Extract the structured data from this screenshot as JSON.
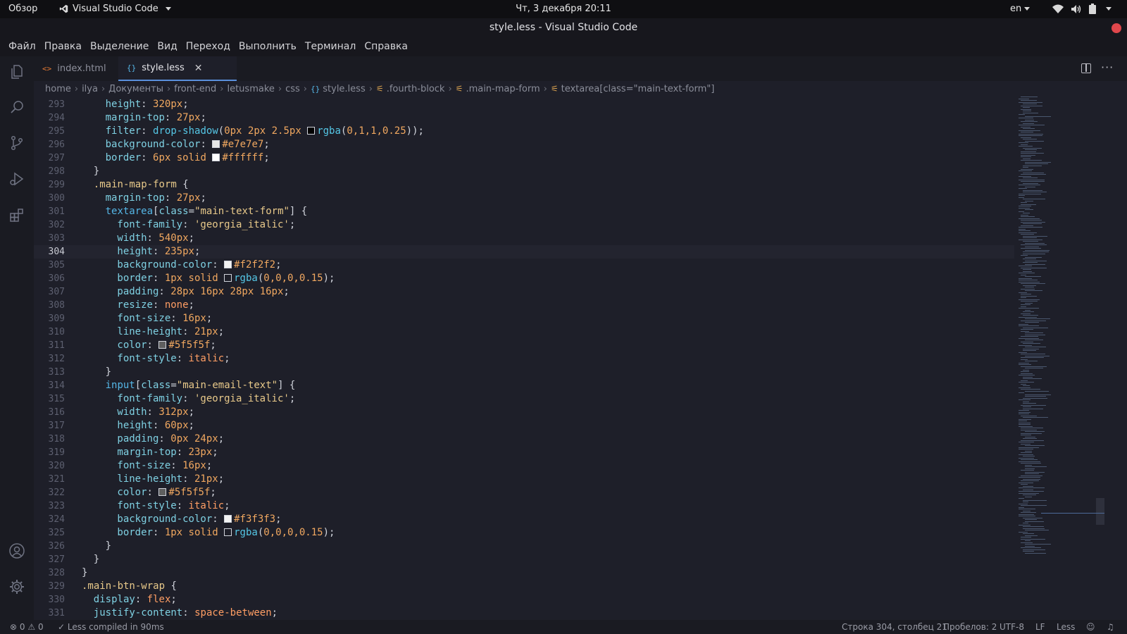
{
  "topbar": {
    "overview": "Обзор",
    "app_name": "Visual Studio Code",
    "clock": "Чт, 3 декабря  20:11",
    "language": "en"
  },
  "window": {
    "title": "style.less - Visual Studio Code"
  },
  "menu": [
    "Файл",
    "Правка",
    "Выделение",
    "Вид",
    "Переход",
    "Выполнить",
    "Терминал",
    "Справка"
  ],
  "tabs": [
    {
      "label": "index.html",
      "icon": "<>"
    },
    {
      "label": "style.less",
      "icon": "{}"
    }
  ],
  "breadcrumb": {
    "folders": [
      "home",
      "ilya",
      "Документы",
      "front-end",
      "letusmake",
      "css"
    ],
    "file": "style.less",
    "symbols": [
      ".fourth-block",
      ".main-map-form",
      "textarea[class=\"main-text-form\"]"
    ]
  },
  "editor": {
    "current_line": 304,
    "lines": [
      {
        "n": "293",
        "i": 2,
        "t": [
          [
            "p",
            "height"
          ],
          [
            "w",
            ": "
          ],
          [
            "n",
            "320px"
          ],
          [
            "w",
            ";"
          ]
        ]
      },
      {
        "n": "294",
        "i": 2,
        "t": [
          [
            "p",
            "margin-top"
          ],
          [
            "w",
            ": "
          ],
          [
            "n",
            "27px"
          ],
          [
            "w",
            ";"
          ]
        ]
      },
      {
        "n": "295",
        "i": 2,
        "t": [
          [
            "p",
            "filter"
          ],
          [
            "w",
            ": "
          ],
          [
            "f",
            "drop-shadow"
          ],
          [
            "w",
            "("
          ],
          [
            "n",
            "0px 2px 2.5px "
          ],
          [
            "sw",
            "#010101"
          ],
          [
            "f",
            "rgba"
          ],
          [
            "w",
            "("
          ],
          [
            "n",
            "0,1,1,0.25"
          ],
          [
            "w",
            "));"
          ]
        ]
      },
      {
        "n": "296",
        "i": 2,
        "t": [
          [
            "p",
            "background-color"
          ],
          [
            "w",
            ": "
          ],
          [
            "sw",
            "#e7e7e7"
          ],
          [
            "n",
            "#e7e7e7"
          ],
          [
            "w",
            ";"
          ]
        ]
      },
      {
        "n": "297",
        "i": 2,
        "t": [
          [
            "p",
            "border"
          ],
          [
            "w",
            ": "
          ],
          [
            "n",
            "6px solid "
          ],
          [
            "sw",
            "#ffffff"
          ],
          [
            "n",
            "#ffffff"
          ],
          [
            "w",
            ";"
          ]
        ]
      },
      {
        "n": "298",
        "i": 1,
        "t": [
          [
            "w",
            "}"
          ]
        ]
      },
      {
        "n": "299",
        "i": 1,
        "t": [
          [
            "sel",
            ".main-map-form"
          ],
          [
            "w",
            " {"
          ]
        ]
      },
      {
        "n": "300",
        "i": 2,
        "t": [
          [
            "p",
            "margin-top"
          ],
          [
            "w",
            ": "
          ],
          [
            "n",
            "27px"
          ],
          [
            "w",
            ";"
          ]
        ]
      },
      {
        "n": "301",
        "i": 2,
        "t": [
          [
            "k",
            "textarea"
          ],
          [
            "w",
            "["
          ],
          [
            "p",
            "class"
          ],
          [
            "w",
            "="
          ],
          [
            "s",
            "\"main-text-form\""
          ],
          [
            "w",
            "] {"
          ]
        ]
      },
      {
        "n": "302",
        "i": 3,
        "t": [
          [
            "p",
            "font-family"
          ],
          [
            "w",
            ": "
          ],
          [
            "s",
            "'georgia_italic'"
          ],
          [
            "w",
            ";"
          ]
        ]
      },
      {
        "n": "303",
        "i": 3,
        "t": [
          [
            "p",
            "width"
          ],
          [
            "w",
            ": "
          ],
          [
            "n",
            "540px"
          ],
          [
            "w",
            ";"
          ]
        ]
      },
      {
        "n": "304",
        "i": 3,
        "t": [
          [
            "p",
            "height"
          ],
          [
            "w",
            ": "
          ],
          [
            "n",
            "235px"
          ],
          [
            "w",
            ";"
          ]
        ]
      },
      {
        "n": "305",
        "i": 3,
        "t": [
          [
            "p",
            "background-color"
          ],
          [
            "w",
            ": "
          ],
          [
            "sw",
            "#f2f2f2"
          ],
          [
            "n",
            "#f2f2f2"
          ],
          [
            "w",
            ";"
          ]
        ]
      },
      {
        "n": "306",
        "i": 3,
        "t": [
          [
            "p",
            "border"
          ],
          [
            "w",
            ": "
          ],
          [
            "n",
            "1px solid "
          ],
          [
            "sw",
            "#1e1f29"
          ],
          [
            "f",
            "rgba"
          ],
          [
            "w",
            "("
          ],
          [
            "n",
            "0,0,0,0.15"
          ],
          [
            "w",
            ");"
          ]
        ]
      },
      {
        "n": "307",
        "i": 3,
        "t": [
          [
            "p",
            "padding"
          ],
          [
            "w",
            ": "
          ],
          [
            "n",
            "28px 16px 28px 16px"
          ],
          [
            "w",
            ";"
          ]
        ]
      },
      {
        "n": "308",
        "i": 3,
        "t": [
          [
            "p",
            "resize"
          ],
          [
            "w",
            ": "
          ],
          [
            "v",
            "none"
          ],
          [
            "w",
            ";"
          ]
        ]
      },
      {
        "n": "309",
        "i": 3,
        "t": [
          [
            "p",
            "font-size"
          ],
          [
            "w",
            ": "
          ],
          [
            "n",
            "16px"
          ],
          [
            "w",
            ";"
          ]
        ]
      },
      {
        "n": "310",
        "i": 3,
        "t": [
          [
            "p",
            "line-height"
          ],
          [
            "w",
            ": "
          ],
          [
            "n",
            "21px"
          ],
          [
            "w",
            ";"
          ]
        ]
      },
      {
        "n": "311",
        "i": 3,
        "t": [
          [
            "p",
            "color"
          ],
          [
            "w",
            ": "
          ],
          [
            "sw",
            "#5f5f5f"
          ],
          [
            "n",
            "#5f5f5f"
          ],
          [
            "w",
            ";"
          ]
        ]
      },
      {
        "n": "312",
        "i": 3,
        "t": [
          [
            "p",
            "font-style"
          ],
          [
            "w",
            ": "
          ],
          [
            "v",
            "italic"
          ],
          [
            "w",
            ";"
          ]
        ]
      },
      {
        "n": "313",
        "i": 2,
        "t": [
          [
            "w",
            "}"
          ]
        ]
      },
      {
        "n": "314",
        "i": 2,
        "t": [
          [
            "k",
            "input"
          ],
          [
            "w",
            "["
          ],
          [
            "p",
            "class"
          ],
          [
            "w",
            "="
          ],
          [
            "s",
            "\"main-email-text\""
          ],
          [
            "w",
            "] {"
          ]
        ]
      },
      {
        "n": "315",
        "i": 3,
        "t": [
          [
            "p",
            "font-family"
          ],
          [
            "w",
            ": "
          ],
          [
            "s",
            "'georgia_italic'"
          ],
          [
            "w",
            ";"
          ]
        ]
      },
      {
        "n": "316",
        "i": 3,
        "t": [
          [
            "p",
            "width"
          ],
          [
            "w",
            ": "
          ],
          [
            "n",
            "312px"
          ],
          [
            "w",
            ";"
          ]
        ]
      },
      {
        "n": "317",
        "i": 3,
        "t": [
          [
            "p",
            "height"
          ],
          [
            "w",
            ": "
          ],
          [
            "n",
            "60px"
          ],
          [
            "w",
            ";"
          ]
        ]
      },
      {
        "n": "318",
        "i": 3,
        "t": [
          [
            "p",
            "padding"
          ],
          [
            "w",
            ": "
          ],
          [
            "n",
            "0px 24px"
          ],
          [
            "w",
            ";"
          ]
        ]
      },
      {
        "n": "319",
        "i": 3,
        "t": [
          [
            "p",
            "margin-top"
          ],
          [
            "w",
            ": "
          ],
          [
            "n",
            "23px"
          ],
          [
            "w",
            ";"
          ]
        ]
      },
      {
        "n": "320",
        "i": 3,
        "t": [
          [
            "p",
            "font-size"
          ],
          [
            "w",
            ": "
          ],
          [
            "n",
            "16px"
          ],
          [
            "w",
            ";"
          ]
        ]
      },
      {
        "n": "321",
        "i": 3,
        "t": [
          [
            "p",
            "line-height"
          ],
          [
            "w",
            ": "
          ],
          [
            "n",
            "21px"
          ],
          [
            "w",
            ";"
          ]
        ]
      },
      {
        "n": "322",
        "i": 3,
        "t": [
          [
            "p",
            "color"
          ],
          [
            "w",
            ": "
          ],
          [
            "sw",
            "#5f5f5f"
          ],
          [
            "n",
            "#5f5f5f"
          ],
          [
            "w",
            ";"
          ]
        ]
      },
      {
        "n": "323",
        "i": 3,
        "t": [
          [
            "p",
            "font-style"
          ],
          [
            "w",
            ": "
          ],
          [
            "v",
            "italic"
          ],
          [
            "w",
            ";"
          ]
        ]
      },
      {
        "n": "324",
        "i": 3,
        "t": [
          [
            "p",
            "background-color"
          ],
          [
            "w",
            ": "
          ],
          [
            "sw",
            "#f3f3f3"
          ],
          [
            "n",
            "#f3f3f3"
          ],
          [
            "w",
            ";"
          ]
        ]
      },
      {
        "n": "325",
        "i": 3,
        "t": [
          [
            "p",
            "border"
          ],
          [
            "w",
            ": "
          ],
          [
            "n",
            "1px solid "
          ],
          [
            "sw",
            "#1e1f29"
          ],
          [
            "f",
            "rgba"
          ],
          [
            "w",
            "("
          ],
          [
            "n",
            "0,0,0,0.15"
          ],
          [
            "w",
            ");"
          ]
        ]
      },
      {
        "n": "326",
        "i": 2,
        "t": [
          [
            "w",
            "}"
          ]
        ]
      },
      {
        "n": "327",
        "i": 1,
        "t": [
          [
            "w",
            "}"
          ]
        ]
      },
      {
        "n": "328",
        "i": 0,
        "t": [
          [
            "w",
            "}"
          ]
        ]
      },
      {
        "n": "329",
        "i": 0,
        "t": [
          [
            "sel",
            ".main-btn-wrap"
          ],
          [
            "w",
            " {"
          ]
        ]
      },
      {
        "n": "330",
        "i": 1,
        "t": [
          [
            "p",
            "display"
          ],
          [
            "w",
            ": "
          ],
          [
            "v",
            "flex"
          ],
          [
            "w",
            ";"
          ]
        ]
      },
      {
        "n": "331",
        "i": 1,
        "t": [
          [
            "p",
            "justify-content"
          ],
          [
            "w",
            ": "
          ],
          [
            "v",
            "space-between"
          ],
          [
            "w",
            ";"
          ]
        ]
      }
    ]
  },
  "status": {
    "errors": "0",
    "warnings": "0",
    "compile": "Less compiled in 90ms",
    "position": "Строка 304, столбец 21",
    "spaces": "Пробелов: 2",
    "encoding": "UTF-8",
    "eol": "LF",
    "language": "Less"
  },
  "colors": {
    "accent": "#5a8fdb",
    "close_button": "#e0474c",
    "editor_bg": "#1e1f29"
  },
  "icons": [
    "files-icon",
    "search-icon",
    "source-control-icon",
    "run-debug-icon",
    "extensions-icon",
    "account-icon",
    "settings-gear-icon",
    "wifi-icon",
    "volume-icon",
    "battery-icon",
    "split-editor-icon",
    "more-actions-icon",
    "bell-icon"
  ]
}
